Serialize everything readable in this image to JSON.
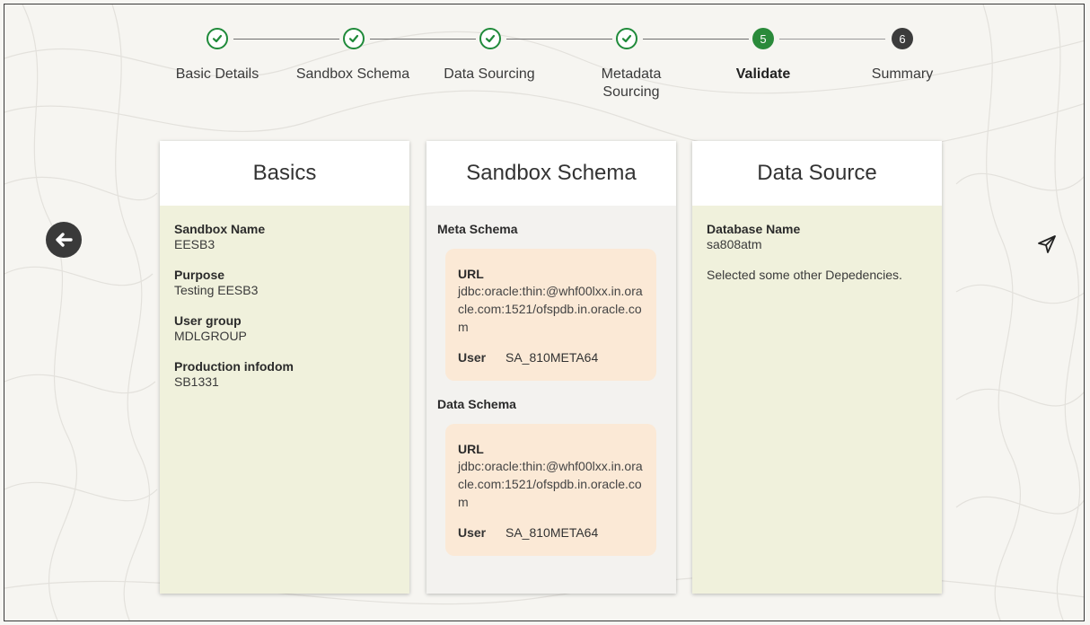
{
  "stepper": {
    "steps": [
      {
        "label": "Basic Details",
        "state": "done"
      },
      {
        "label": "Sandbox Schema",
        "state": "done"
      },
      {
        "label": "Data Sourcing",
        "state": "done"
      },
      {
        "label": "Metadata Sourcing",
        "label_lines": [
          "Metadata",
          "Sourcing"
        ],
        "state": "done"
      },
      {
        "label": "Validate",
        "state": "current",
        "number": "5"
      },
      {
        "label": "Summary",
        "state": "todo",
        "number": "6"
      }
    ]
  },
  "cards": {
    "basics": {
      "title": "Basics",
      "fields": [
        {
          "label": "Sandbox Name",
          "value": "EESB3"
        },
        {
          "label": "Purpose",
          "value": "Testing EESB3"
        },
        {
          "label": "User group",
          "value": "MDLGROUP"
        },
        {
          "label": "Production infodom",
          "value": "SB1331"
        }
      ]
    },
    "sandbox_schema": {
      "title": "Sandbox Schema",
      "meta_schema": {
        "heading": "Meta Schema",
        "url_label": "URL",
        "url": "jdbc:oracle:thin:@whf00lxx.in.oracle.com:1521/ofspdb.in.oracle.com",
        "user_label": "User",
        "user": "SA_810META64"
      },
      "data_schema": {
        "heading": "Data Schema",
        "url_label": "URL",
        "url": "jdbc:oracle:thin:@whf00lxx.in.oracle.com:1521/ofspdb.in.oracle.com",
        "user_label": "User",
        "user": "SA_810META64"
      }
    },
    "data_source": {
      "title": "Data Source",
      "db_label": "Database Name",
      "db_value": "sa808atm",
      "note": "Selected some other Depedencies."
    }
  },
  "nav": {
    "back_icon": "arrow-left-circle-icon",
    "send_icon": "paper-plane-icon"
  },
  "colors": {
    "done": "#1f8a3a",
    "current": "#2a8a3a",
    "todo": "#3c3c3c",
    "card_body": "#f0f1dc",
    "conn_box": "#fbe9d6"
  }
}
